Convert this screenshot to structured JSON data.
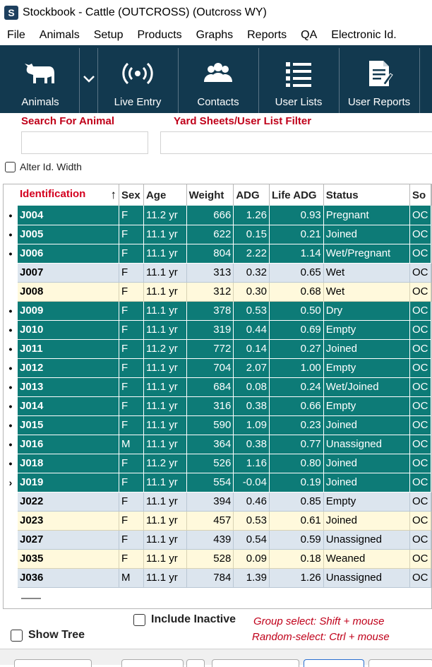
{
  "window": {
    "title": "Stockbook - Cattle (OUTCROSS) (Outcross WY)",
    "app_icon": "S"
  },
  "menu": [
    "File",
    "Animals",
    "Setup",
    "Products",
    "Graphs",
    "Reports",
    "QA",
    "Electronic Id."
  ],
  "ribbon": {
    "animals": "Animals",
    "live_entry": "Live Entry",
    "contacts": "Contacts",
    "user_lists": "User Lists",
    "user_reports": "User Reports"
  },
  "search": {
    "label": "Search For Animal",
    "value": ""
  },
  "filter": {
    "label": "Yard Sheets/User List Filter",
    "value": ""
  },
  "alter_id": {
    "label": "Alter Id. Width",
    "checked": false
  },
  "grid": {
    "columns": [
      "Identification",
      "Sex",
      "Age",
      "Weight",
      "ADG",
      "Life ADG",
      "Status",
      "So"
    ],
    "sort_arrow": "↑",
    "rows": [
      {
        "mark": "•",
        "id": "J004",
        "sex": "F",
        "age": "11.2 yr",
        "weight": "666",
        "adg": "1.26",
        "life_adg": "0.93",
        "status": "Pregnant",
        "so": "OC",
        "selected": true
      },
      {
        "mark": "•",
        "id": "J005",
        "sex": "F",
        "age": "11.1 yr",
        "weight": "622",
        "adg": "0.15",
        "life_adg": "0.21",
        "status": "Joined",
        "so": "OC",
        "selected": true
      },
      {
        "mark": "•",
        "id": "J006",
        "sex": "F",
        "age": "11.1 yr",
        "weight": "804",
        "adg": "2.22",
        "life_adg": "1.14",
        "status": "Wet/Pregnant",
        "so": "OC",
        "selected": true
      },
      {
        "mark": "",
        "id": "J007",
        "sex": "F",
        "age": "11.1 yr",
        "weight": "313",
        "adg": "0.32",
        "life_adg": "0.65",
        "status": "Wet",
        "so": "OC",
        "selected": false
      },
      {
        "mark": "",
        "id": "J008",
        "sex": "F",
        "age": "11.1 yr",
        "weight": "312",
        "adg": "0.30",
        "life_adg": "0.68",
        "status": "Wet",
        "so": "OC",
        "selected": false
      },
      {
        "mark": "•",
        "id": "J009",
        "sex": "F",
        "age": "11.1 yr",
        "weight": "378",
        "adg": "0.53",
        "life_adg": "0.50",
        "status": "Dry",
        "so": "OC",
        "selected": true
      },
      {
        "mark": "•",
        "id": "J010",
        "sex": "F",
        "age": "11.1 yr",
        "weight": "319",
        "adg": "0.44",
        "life_adg": "0.69",
        "status": "Empty",
        "so": "OC",
        "selected": true
      },
      {
        "mark": "•",
        "id": "J011",
        "sex": "F",
        "age": "11.2 yr",
        "weight": "772",
        "adg": "0.14",
        "life_adg": "0.27",
        "status": "Joined",
        "so": "OC",
        "selected": true
      },
      {
        "mark": "•",
        "id": "J012",
        "sex": "F",
        "age": "11.1 yr",
        "weight": "704",
        "adg": "2.07",
        "life_adg": "1.00",
        "status": "Empty",
        "so": "OC",
        "selected": true
      },
      {
        "mark": "•",
        "id": "J013",
        "sex": "F",
        "age": "11.1 yr",
        "weight": "684",
        "adg": "0.08",
        "life_adg": "0.24",
        "status": "Wet/Joined",
        "so": "OC",
        "selected": true
      },
      {
        "mark": "•",
        "id": "J014",
        "sex": "F",
        "age": "11.1 yr",
        "weight": "316",
        "adg": "0.38",
        "life_adg": "0.66",
        "status": "Empty",
        "so": "OC",
        "selected": true
      },
      {
        "mark": "•",
        "id": "J015",
        "sex": "F",
        "age": "11.1 yr",
        "weight": "590",
        "adg": "1.09",
        "life_adg": "0.23",
        "status": "Joined",
        "so": "OC",
        "selected": true
      },
      {
        "mark": "•",
        "id": "J016",
        "sex": "M",
        "age": "11.1 yr",
        "weight": "364",
        "adg": "0.38",
        "life_adg": "0.77",
        "status": "Unassigned",
        "so": "OC",
        "selected": true
      },
      {
        "mark": "•",
        "id": "J018",
        "sex": "F",
        "age": "11.2 yr",
        "weight": "526",
        "adg": "1.16",
        "life_adg": "0.80",
        "status": "Joined",
        "so": "OC",
        "selected": true
      },
      {
        "mark": "›",
        "id": "J019",
        "sex": "F",
        "age": "11.1 yr",
        "weight": "554",
        "adg": "-0.04",
        "life_adg": "0.19",
        "status": "Joined",
        "so": "OC",
        "selected": true
      },
      {
        "mark": "",
        "id": "J022",
        "sex": "F",
        "age": "11.1 yr",
        "weight": "394",
        "adg": "0.46",
        "life_adg": "0.85",
        "status": "Empty",
        "so": "OC",
        "selected": false
      },
      {
        "mark": "",
        "id": "J023",
        "sex": "F",
        "age": "11.1 yr",
        "weight": "457",
        "adg": "0.53",
        "life_adg": "0.61",
        "status": "Joined",
        "so": "OC",
        "selected": false
      },
      {
        "mark": "",
        "id": "J027",
        "sex": "F",
        "age": "11.1 yr",
        "weight": "439",
        "adg": "0.54",
        "life_adg": "0.59",
        "status": "Unassigned",
        "so": "OC",
        "selected": false
      },
      {
        "mark": "",
        "id": "J035",
        "sex": "F",
        "age": "11.1 yr",
        "weight": "528",
        "adg": "0.09",
        "life_adg": "0.18",
        "status": "Weaned",
        "so": "OC",
        "selected": false
      },
      {
        "mark": "",
        "id": "J036",
        "sex": "M",
        "age": "11.1 yr",
        "weight": "784",
        "adg": "1.39",
        "life_adg": "1.26",
        "status": "Unassigned",
        "so": "OC",
        "selected": false
      }
    ]
  },
  "include_inactive": {
    "label": "Include Inactive",
    "checked": false
  },
  "show_tree": {
    "label": "Show Tree",
    "checked": false
  },
  "hints": {
    "group": "Group select: Shift + mouse",
    "random": "Random-select: Ctrl + mouse"
  },
  "colors": {
    "ribbon": "#12394f",
    "selected_row": "#0d7b77",
    "accent_red": "#c0001a"
  }
}
